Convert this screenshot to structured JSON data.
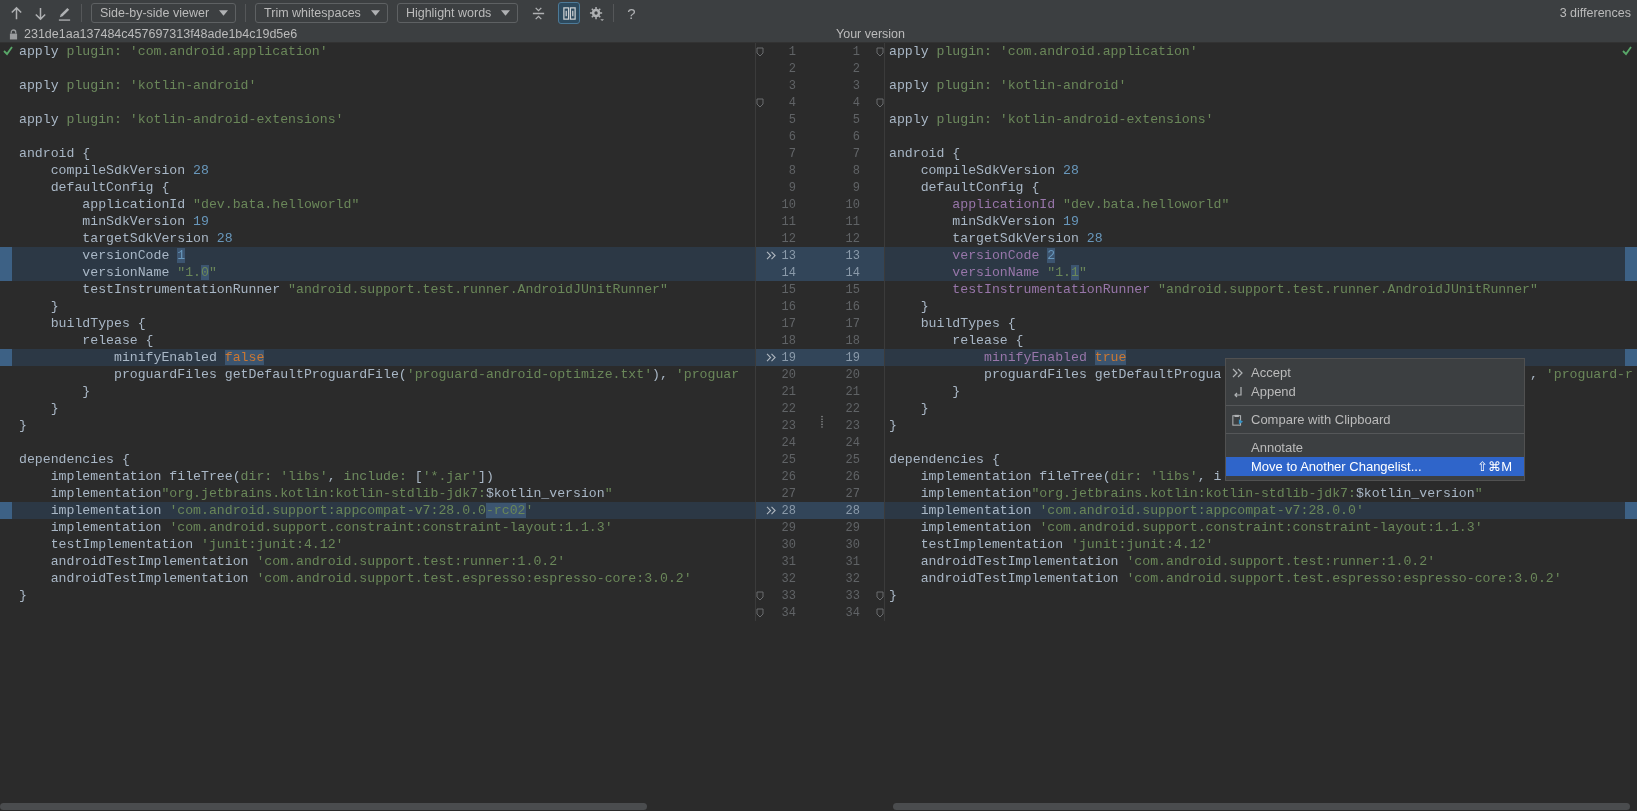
{
  "toolbar": {
    "items": [
      {
        "kind": "up"
      },
      {
        "kind": "down"
      },
      {
        "kind": "edit"
      },
      {
        "kind": "separator"
      },
      {
        "kind": "dropdown",
        "label": "Side-by-side viewer"
      },
      {
        "kind": "separator"
      },
      {
        "kind": "dropdown",
        "label": "Trim whitespaces"
      },
      {
        "kind": "dropdown",
        "label": "Highlight words"
      },
      {
        "kind": "collapse",
        "on": false
      },
      {
        "kind": "sync",
        "on": true
      },
      {
        "kind": "settings"
      },
      {
        "kind": "separator"
      },
      {
        "kind": "help",
        "label": "?"
      }
    ],
    "summary": "3 differences"
  },
  "header": {
    "revision": "231de1aa137484c457697313f48ade1b4c19d5e6",
    "right_title": "Your version"
  },
  "rows": [
    {
      "left_number": "1",
      "right_number": "1",
      "changed": false,
      "fold": true,
      "left": [
        {
          "text": "apply ",
          "kind": "plain"
        },
        {
          "text": "plugin:",
          "kind": "label"
        },
        {
          "text": " 'com.android.application'",
          "kind": "string"
        }
      ],
      "right": [
        {
          "text": "apply ",
          "kind": "plain"
        },
        {
          "text": "plugin:",
          "kind": "label"
        },
        {
          "text": " 'com.android.application'",
          "kind": "string"
        }
      ]
    },
    {
      "left_number": "2",
      "right_number": "2",
      "changed": false,
      "fold": false,
      "left": [],
      "right": []
    },
    {
      "left_number": "3",
      "right_number": "3",
      "changed": false,
      "fold": false,
      "left": [
        {
          "text": "apply ",
          "kind": "plain"
        },
        {
          "text": "plugin:",
          "kind": "label"
        },
        {
          "text": " 'kotlin-android'",
          "kind": "string"
        }
      ],
      "right": [
        {
          "text": "apply ",
          "kind": "plain"
        },
        {
          "text": "plugin:",
          "kind": "label"
        },
        {
          "text": " 'kotlin-android'",
          "kind": "string"
        }
      ]
    },
    {
      "left_number": "4",
      "right_number": "4",
      "changed": false,
      "fold": true,
      "left": [],
      "right": []
    },
    {
      "left_number": "5",
      "right_number": "5",
      "changed": false,
      "fold": false,
      "left": [
        {
          "text": "apply ",
          "kind": "plain"
        },
        {
          "text": "plugin:",
          "kind": "label"
        },
        {
          "text": " 'kotlin-android-extensions'",
          "kind": "string"
        }
      ],
      "right": [
        {
          "text": "apply ",
          "kind": "plain"
        },
        {
          "text": "plugin:",
          "kind": "label"
        },
        {
          "text": " 'kotlin-android-extensions'",
          "kind": "string"
        }
      ]
    },
    {
      "left_number": "6",
      "right_number": "6",
      "changed": false,
      "fold": false,
      "left": [],
      "right": []
    },
    {
      "left_number": "7",
      "right_number": "7",
      "changed": false,
      "fold": false,
      "left": [
        {
          "text": "android {",
          "kind": "plain"
        }
      ],
      "right": [
        {
          "text": "android {",
          "kind": "plain"
        }
      ]
    },
    {
      "left_number": "8",
      "right_number": "8",
      "changed": false,
      "fold": false,
      "left": [
        {
          "text": "    compileSdkVersion ",
          "kind": "plain"
        },
        {
          "text": "28",
          "kind": "number"
        }
      ],
      "right": [
        {
          "text": "    compileSdkVersion ",
          "kind": "plain"
        },
        {
          "text": "28",
          "kind": "number"
        }
      ]
    },
    {
      "left_number": "9",
      "right_number": "9",
      "changed": false,
      "fold": false,
      "left": [
        {
          "text": "    defaultConfig {",
          "kind": "plain"
        }
      ],
      "right": [
        {
          "text": "    defaultConfig {",
          "kind": "plain"
        }
      ]
    },
    {
      "left_number": "10",
      "right_number": "10",
      "changed": false,
      "fold": false,
      "left": [
        {
          "text": "        applicationId ",
          "kind": "plain"
        },
        {
          "text": "\"dev.bata.helloworld\"",
          "kind": "string"
        }
      ],
      "right": [
        {
          "text": "        applicationId",
          "kind": "property"
        },
        {
          "text": " \"dev.bata.helloworld\"",
          "kind": "string"
        }
      ]
    },
    {
      "left_number": "11",
      "right_number": "11",
      "changed": false,
      "fold": false,
      "left": [
        {
          "text": "        minSdkVersion ",
          "kind": "plain"
        },
        {
          "text": "19",
          "kind": "number"
        }
      ],
      "right": [
        {
          "text": "        minSdkVersion ",
          "kind": "plain"
        },
        {
          "text": "19",
          "kind": "number"
        }
      ]
    },
    {
      "left_number": "12",
      "right_number": "12",
      "changed": false,
      "fold": false,
      "left": [
        {
          "text": "        targetSdkVersion ",
          "kind": "plain"
        },
        {
          "text": "28",
          "kind": "number"
        }
      ],
      "right": [
        {
          "text": "        targetSdkVersion ",
          "kind": "plain"
        },
        {
          "text": "28",
          "kind": "number"
        }
      ]
    },
    {
      "left_number": "13",
      "right_number": "13",
      "changed": true,
      "fold": false,
      "left": [
        {
          "text": "        versionCode ",
          "kind": "plain"
        },
        {
          "text": "1",
          "kind": "number_changed"
        }
      ],
      "right": [
        {
          "text": "        versionCode ",
          "kind": "property"
        },
        {
          "text": "2",
          "kind": "number_changed"
        }
      ]
    },
    {
      "left_number": "14",
      "right_number": "14",
      "changed": true,
      "fold": false,
      "left": [
        {
          "text": "        versionName ",
          "kind": "plain"
        },
        {
          "text": "\"1.",
          "kind": "string"
        },
        {
          "text": "0",
          "kind": "string_changed"
        },
        {
          "text": "\"",
          "kind": "string"
        }
      ],
      "right": [
        {
          "text": "        versionName",
          "kind": "property"
        },
        {
          "text": " \"1.",
          "kind": "string"
        },
        {
          "text": "1",
          "kind": "string_changed"
        },
        {
          "text": "\"",
          "kind": "string"
        }
      ]
    },
    {
      "left_number": "15",
      "right_number": "15",
      "changed": false,
      "fold": false,
      "left": [
        {
          "text": "        testInstrumentationRunner ",
          "kind": "plain"
        },
        {
          "text": "\"android.support.test.runner.AndroidJUnitRunner\"",
          "kind": "string"
        }
      ],
      "right": [
        {
          "text": "        testInstrumentationRunner",
          "kind": "property"
        },
        {
          "text": " \"android.support.test.runner.AndroidJUnitRunner\"",
          "kind": "string"
        }
      ]
    },
    {
      "left_number": "16",
      "right_number": "16",
      "changed": false,
      "fold": false,
      "left": [
        {
          "text": "    }",
          "kind": "plain"
        }
      ],
      "right": [
        {
          "text": "    }",
          "kind": "plain"
        }
      ]
    },
    {
      "left_number": "17",
      "right_number": "17",
      "changed": false,
      "fold": false,
      "left": [
        {
          "text": "    buildTypes {",
          "kind": "plain"
        }
      ],
      "right": [
        {
          "text": "    buildTypes {",
          "kind": "plain"
        }
      ]
    },
    {
      "left_number": "18",
      "right_number": "18",
      "changed": false,
      "fold": false,
      "left": [
        {
          "text": "        release {",
          "kind": "plain"
        }
      ],
      "right": [
        {
          "text": "        release {",
          "kind": "plain"
        }
      ]
    },
    {
      "left_number": "19",
      "right_number": "19",
      "changed": true,
      "fold": false,
      "left": [
        {
          "text": "            minifyEnabled ",
          "kind": "plain"
        },
        {
          "text": "false",
          "kind": "keyword_changed"
        }
      ],
      "right": [
        {
          "text": "            minifyEnabled ",
          "kind": "property"
        },
        {
          "text": "true",
          "kind": "keyword_changed"
        }
      ]
    },
    {
      "left_number": "20",
      "right_number": "20",
      "changed": false,
      "fold": false,
      "left": [
        {
          "text": "            proguardFiles getDefaultProguardFile(",
          "kind": "plain"
        },
        {
          "text": "'proguard-android-optimize.txt'",
          "kind": "string"
        },
        {
          "text": "), ",
          "kind": "plain"
        },
        {
          "text": "'proguar",
          "kind": "string"
        }
      ],
      "right": [
        {
          "text": "            proguardFiles getDefaultProgua",
          "kind": "plain"
        }
      ],
      "right_tail": [
        {
          "text": ", ",
          "kind": "plain"
        },
        {
          "text": "'proguard-r",
          "kind": "string"
        }
      ]
    },
    {
      "left_number": "21",
      "right_number": "21",
      "changed": false,
      "fold": false,
      "left": [
        {
          "text": "        }",
          "kind": "plain"
        }
      ],
      "right": [
        {
          "text": "        }",
          "kind": "plain"
        }
      ]
    },
    {
      "left_number": "22",
      "right_number": "22",
      "changed": false,
      "fold": false,
      "left": [
        {
          "text": "    }",
          "kind": "plain"
        }
      ],
      "right": [
        {
          "text": "    }",
          "kind": "plain"
        }
      ]
    },
    {
      "left_number": "23",
      "right_number": "23",
      "changed": false,
      "fold": false,
      "left": [
        {
          "text": "}",
          "kind": "plain"
        }
      ],
      "right": [
        {
          "text": "}",
          "kind": "plain"
        }
      ]
    },
    {
      "left_number": "24",
      "right_number": "24",
      "changed": false,
      "fold": false,
      "left": [],
      "right": []
    },
    {
      "left_number": "25",
      "right_number": "25",
      "changed": false,
      "fold": false,
      "left": [
        {
          "text": "dependencies {",
          "kind": "plain"
        }
      ],
      "right": [
        {
          "text": "dependencies {",
          "kind": "plain"
        }
      ]
    },
    {
      "left_number": "26",
      "right_number": "26",
      "changed": false,
      "fold": false,
      "left": [
        {
          "text": "    implementation fileTree(",
          "kind": "plain"
        },
        {
          "text": "dir:",
          "kind": "label"
        },
        {
          "text": " 'libs'",
          "kind": "string"
        },
        {
          "text": ", ",
          "kind": "plain"
        },
        {
          "text": "include:",
          "kind": "label"
        },
        {
          "text": " [",
          "kind": "plain"
        },
        {
          "text": "'*.jar'",
          "kind": "string"
        },
        {
          "text": "])",
          "kind": "plain"
        }
      ],
      "right": [
        {
          "text": "    implementation fileTree(",
          "kind": "plain"
        },
        {
          "text": "dir:",
          "kind": "label"
        },
        {
          "text": " 'libs'",
          "kind": "string"
        },
        {
          "text": ", i",
          "kind": "plain"
        }
      ]
    },
    {
      "left_number": "27",
      "right_number": "27",
      "changed": false,
      "fold": false,
      "left": [
        {
          "text": "    implementation",
          "kind": "plain"
        },
        {
          "text": "\"org.jetbrains.kotlin:kotlin-stdlib-jdk7:",
          "kind": "string"
        },
        {
          "text": "$kotlin_version",
          "kind": "plain"
        },
        {
          "text": "\"",
          "kind": "string"
        }
      ],
      "right": [
        {
          "text": "    implementation",
          "kind": "plain"
        },
        {
          "text": "\"org.jetbrains.kotlin:kotlin-stdlib-jdk7:",
          "kind": "string"
        },
        {
          "text": "$kotlin_version",
          "kind": "plain"
        },
        {
          "text": "\"",
          "kind": "string"
        }
      ]
    },
    {
      "left_number": "28",
      "right_number": "28",
      "changed": true,
      "fold": false,
      "left": [
        {
          "text": "    implementation ",
          "kind": "plain"
        },
        {
          "text": "'com.android.support:appcompat-v7:28.0.0",
          "kind": "string"
        },
        {
          "text": "-rc02",
          "kind": "string_changed"
        },
        {
          "text": "'",
          "kind": "string"
        }
      ],
      "right": [
        {
          "text": "    implementation ",
          "kind": "plain"
        },
        {
          "text": "'com.android.support:appcompat-v7:28.0.0'",
          "kind": "string"
        }
      ]
    },
    {
      "left_number": "29",
      "right_number": "29",
      "changed": false,
      "fold": false,
      "left": [
        {
          "text": "    implementation ",
          "kind": "plain"
        },
        {
          "text": "'com.android.support.constraint:constraint-layout:1.1.3'",
          "kind": "string"
        }
      ],
      "right": [
        {
          "text": "    implementation ",
          "kind": "plain"
        },
        {
          "text": "'com.android.support.constraint:constraint-layout:1.1.3'",
          "kind": "string"
        }
      ]
    },
    {
      "left_number": "30",
      "right_number": "30",
      "changed": false,
      "fold": false,
      "left": [
        {
          "text": "    testImplementation ",
          "kind": "plain"
        },
        {
          "text": "'junit:junit:4.12'",
          "kind": "string"
        }
      ],
      "right": [
        {
          "text": "    testImplementation ",
          "kind": "plain"
        },
        {
          "text": "'junit:junit:4.12'",
          "kind": "string"
        }
      ]
    },
    {
      "left_number": "31",
      "right_number": "31",
      "changed": false,
      "fold": false,
      "left": [
        {
          "text": "    androidTestImplementation ",
          "kind": "plain"
        },
        {
          "text": "'com.android.support.test:runner:1.0.2'",
          "kind": "string"
        }
      ],
      "right": [
        {
          "text": "    androidTestImplementation ",
          "kind": "plain"
        },
        {
          "text": "'com.android.support.test:runner:1.0.2'",
          "kind": "string"
        }
      ]
    },
    {
      "left_number": "32",
      "right_number": "32",
      "changed": false,
      "fold": false,
      "left": [
        {
          "text": "    androidTestImplementation ",
          "kind": "plain"
        },
        {
          "text": "'com.android.support.test.espresso:espresso-core:3.0.2'",
          "kind": "string"
        }
      ],
      "right": [
        {
          "text": "    androidTestImplementation ",
          "kind": "plain"
        },
        {
          "text": "'com.android.support.test.espresso:espresso-core:3.0.2'",
          "kind": "string"
        }
      ]
    },
    {
      "left_number": "33",
      "right_number": "33",
      "changed": false,
      "fold": true,
      "left": [
        {
          "text": "}",
          "kind": "plain"
        }
      ],
      "right": [
        {
          "text": "}",
          "kind": "plain"
        }
      ]
    },
    {
      "left_number": "34",
      "right_number": "34",
      "changed": false,
      "fold": true,
      "left": [],
      "right": []
    }
  ],
  "context_menu": {
    "items": [
      {
        "kind": "chevrons",
        "label": "Accept",
        "selected": false
      },
      {
        "kind": "corner",
        "label": "Append",
        "selected": false
      },
      {
        "kind": "separator"
      },
      {
        "kind": "clipboard",
        "label": "Compare with Clipboard",
        "selected": false
      },
      {
        "kind": "separator"
      },
      {
        "kind": "text",
        "label": "Annotate",
        "selected": false
      },
      {
        "kind": "text",
        "label": "Move to Another Changelist...",
        "shortcut": "⇧⌘M",
        "selected": true
      }
    ]
  }
}
